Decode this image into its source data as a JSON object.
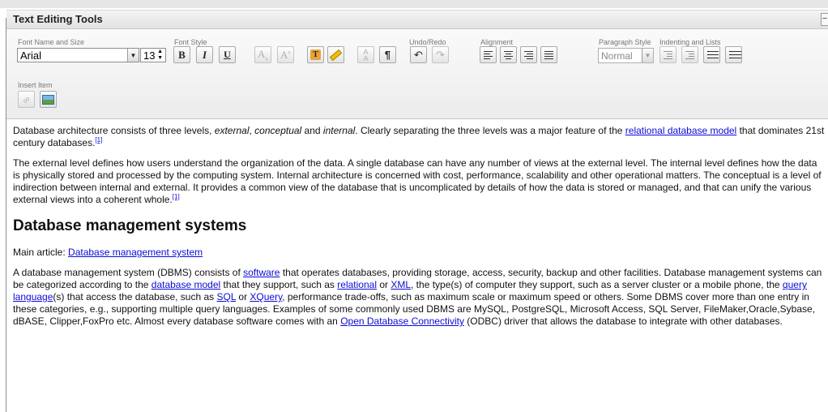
{
  "panel": {
    "title": "Text Editing Tools",
    "collapse_glyph": "−"
  },
  "toolbar": {
    "font_group_label": "Font Name and Size",
    "font_name": "Arial",
    "font_size": "13",
    "style_group_label": "Font Style",
    "bold": "B",
    "italic": "I",
    "underline": "U",
    "subscript": "Ax",
    "superscript": "Ax",
    "undo_group_label": "Undo/Redo",
    "align_group_label": "Alignment",
    "para_group_label": "Paragraph Style",
    "para_style": "Normal",
    "indent_group_label": "Indenting and Lists",
    "insert_group_label": "Insert Item",
    "pilcrow": "¶",
    "icons": [
      "bold-icon",
      "italic-icon",
      "underline-icon",
      "subscript-icon",
      "superscript-icon",
      "text-color-icon",
      "highlight-icon",
      "font-size-icon",
      "pilcrow-icon",
      "undo-icon",
      "redo-icon",
      "align-left-icon",
      "align-center-icon",
      "align-right-icon",
      "justify-icon",
      "outdent-icon",
      "indent-icon",
      "bullet-list-icon",
      "numbered-list-icon",
      "link-icon",
      "image-icon"
    ]
  },
  "content": {
    "p1": {
      "a": "Database architecture consists of three levels, ",
      "external": "external",
      "b": ", ",
      "conceptual": "conceptual",
      "c": " and ",
      "internal": "internal",
      "d": ". Clearly separating the three levels was a major feature of the ",
      "link": "relational database model",
      "e": " that dominates 21st century databases.",
      "ref": "[1]"
    },
    "p2": {
      "text": "The external level defines how users understand the organization of the data. A single database can have any number of views at the external level. The internal level defines how the data is physically stored and processed by the computing system. Internal architecture is concerned with cost, performance, scalability and other operational matters. The conceptual is a level of indirection between internal and external. It provides a common view of the database that is uncomplicated by details of how the data is stored or managed, and that can unify the various external views into a coherent whole.",
      "ref": "[1]"
    },
    "heading": "Database management systems",
    "main_article": {
      "prefix": "Main article: ",
      "link": "Database management system"
    },
    "p3": {
      "a": "A database management system (DBMS) consists of ",
      "software": "software",
      "b": " that operates databases, providing storage, access, security, backup and other facilities. Database management systems can be categorized according to the ",
      "database_model": "database model",
      "c": " that they support, such as ",
      "relational": "relational",
      "d": " or ",
      "xml": "XML",
      "e": ", the type(s) of computer they support, such as a server cluster or a mobile phone, the ",
      "query_language": "query language",
      "f": "(s) that access the database, such as ",
      "sql": "SQL",
      "g": " or ",
      "xquery": "XQuery",
      "h": ", performance trade-offs, such as maximum scale or maximum speed or others. Some DBMS cover more than one entry in these categories, e.g., supporting multiple query languages. Examples of some commonly used DBMS are MySQL, PostgreSQL, Microsoft Access, SQL Server, FileMaker,Oracle,Sybase, dBASE, Clipper,FoxPro etc. Almost every database software comes with an ",
      "odbc": "Open Database Connectivity",
      "i": " (ODBC) driver that allows the database to integrate with other databases."
    }
  }
}
